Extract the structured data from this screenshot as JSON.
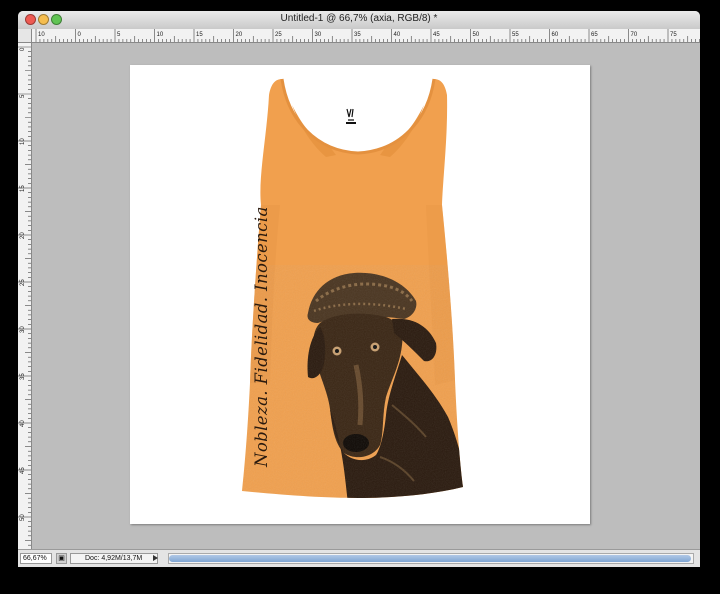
{
  "window": {
    "title": "Untitled-1 @ 66,7% (axia, RGB/8) *"
  },
  "rulers": {
    "top_labels": [
      "10",
      "0",
      "5",
      "10",
      "15",
      "20",
      "25",
      "30",
      "35",
      "40",
      "45",
      "50",
      "55",
      "60",
      "65",
      "70",
      "75"
    ],
    "left_labels": [
      "0",
      "5",
      "10",
      "15",
      "20",
      "25",
      "30",
      "35",
      "40",
      "45",
      "50"
    ]
  },
  "artwork": {
    "tagline": "Nobleza. Fidelidad. Inocencia",
    "garment_color": "#f1a04e",
    "ink_color": "#2a1a0e"
  },
  "status": {
    "zoom": "66,67%",
    "doc_info": "Doc: 4,92M/13,7M"
  }
}
